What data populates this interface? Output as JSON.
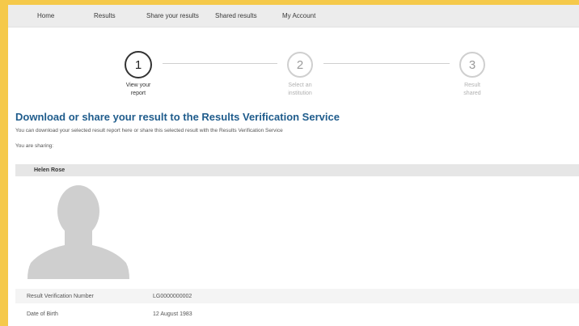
{
  "nav": {
    "items": [
      "Home",
      "Results",
      "Share your results",
      "Shared results",
      "My Account"
    ]
  },
  "stepper": {
    "steps": [
      {
        "number": "1",
        "label_line1": "View your",
        "label_line2": "report",
        "state": "active"
      },
      {
        "number": "2",
        "label_line1": "Select an",
        "label_line2": "institution",
        "state": "inactive"
      },
      {
        "number": "3",
        "label_line1": "Result",
        "label_line2": "shared",
        "state": "inactive"
      }
    ]
  },
  "main": {
    "title": "Download or share your result to the Results Verification Service",
    "description": "You can download your selected result report here or share this selected result with the Results Verification Service",
    "sharing_label": "You are sharing:"
  },
  "person": {
    "name": "Helen Rose",
    "avatar_icon": "person-silhouette-icon"
  },
  "details": [
    {
      "label": "Result Verification Number",
      "value": "LG0000000002"
    },
    {
      "label": "Date of Birth",
      "value": "12 August 1983"
    }
  ],
  "colors": {
    "accent_border": "#f5c94a",
    "title_blue": "#1f5c8c",
    "nav_bg": "#ececec"
  }
}
